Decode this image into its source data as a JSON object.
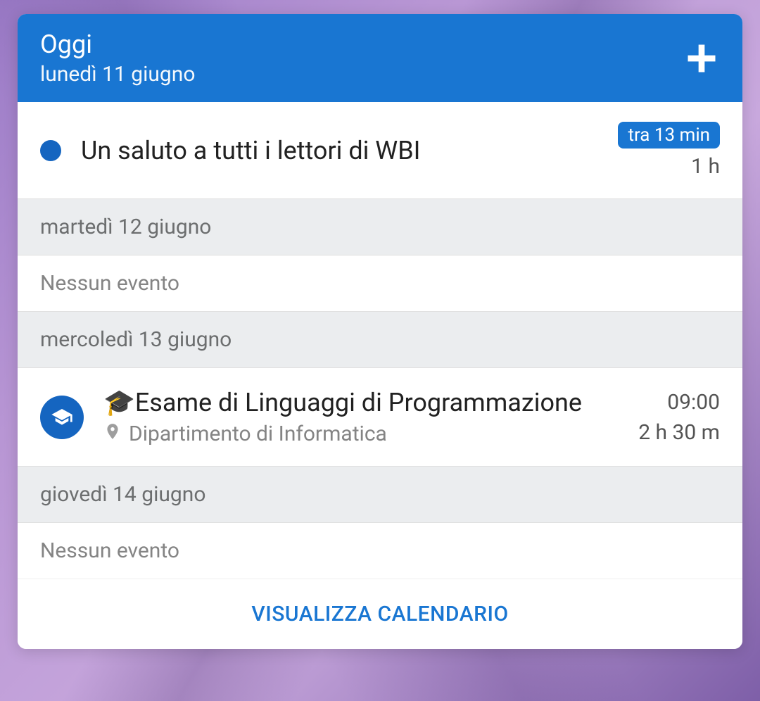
{
  "header": {
    "title": "Oggi",
    "date": "lunedì 11 giugno"
  },
  "event1": {
    "title": "Un saluto a tutti i lettori di WBI",
    "countdown": "tra 13 min",
    "duration": "1 h"
  },
  "day2": {
    "label": "martedì 12 giugno",
    "empty": "Nessun evento"
  },
  "day3": {
    "label": "mercoledì 13 giugno"
  },
  "event2": {
    "title": "Esame di Linguaggi di Programmazione",
    "location": "Dipartimento di Informatica",
    "time": "09:00",
    "duration": "2 h 30 m"
  },
  "day4": {
    "label": "giovedì 14 giugno",
    "empty": "Nessun evento"
  },
  "footer": {
    "label": "VISUALIZZA CALENDARIO"
  }
}
